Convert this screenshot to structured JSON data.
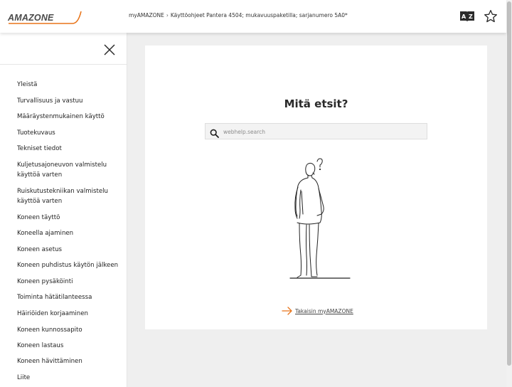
{
  "header": {
    "logo_text": "AMAZONE",
    "breadcrumb": [
      {
        "label": "myAMAZONE"
      },
      {
        "label": "Käyttöohjeet Pantera 4504; mukavuuspaketilla; sarjanumero 5A0*"
      }
    ],
    "breadcrumb_separator": "›",
    "icons": [
      "language-dictionary-icon",
      "star-icon"
    ]
  },
  "sidebar": {
    "items": [
      {
        "label": "Yleistä"
      },
      {
        "label": "Turvallisuus ja vastuu"
      },
      {
        "label": "Määräystenmukainen käyttö"
      },
      {
        "label": "Tuotekuvaus"
      },
      {
        "label": "Tekniset tiedot"
      },
      {
        "label": "Kuljetusajoneuvon valmistelu käyttöä varten"
      },
      {
        "label": "Ruiskutustekniikan valmistelu käyttöä varten"
      },
      {
        "label": "Koneen täyttö"
      },
      {
        "label": "Koneella ajaminen"
      },
      {
        "label": "Koneen asetus"
      },
      {
        "label": "Koneen puhdistus käytön jälkeen"
      },
      {
        "label": "Koneen pysäköinti"
      },
      {
        "label": "Toiminta hätätilanteessa"
      },
      {
        "label": "Häiriöiden korjaaminen"
      },
      {
        "label": "Koneen kunnossapito"
      },
      {
        "label": "Koneen lastaus"
      },
      {
        "label": "Koneen hävittäminen"
      },
      {
        "label": "Liite"
      }
    ]
  },
  "main": {
    "title": "Mitä etsit?",
    "search": {
      "placeholder": "webhelp.search",
      "value": ""
    },
    "back_link": "Takaisin myAMAZONE"
  },
  "colors": {
    "brand_orange": "#e8741a",
    "logo_grey": "#4a4a4a",
    "background": "#efefef"
  }
}
